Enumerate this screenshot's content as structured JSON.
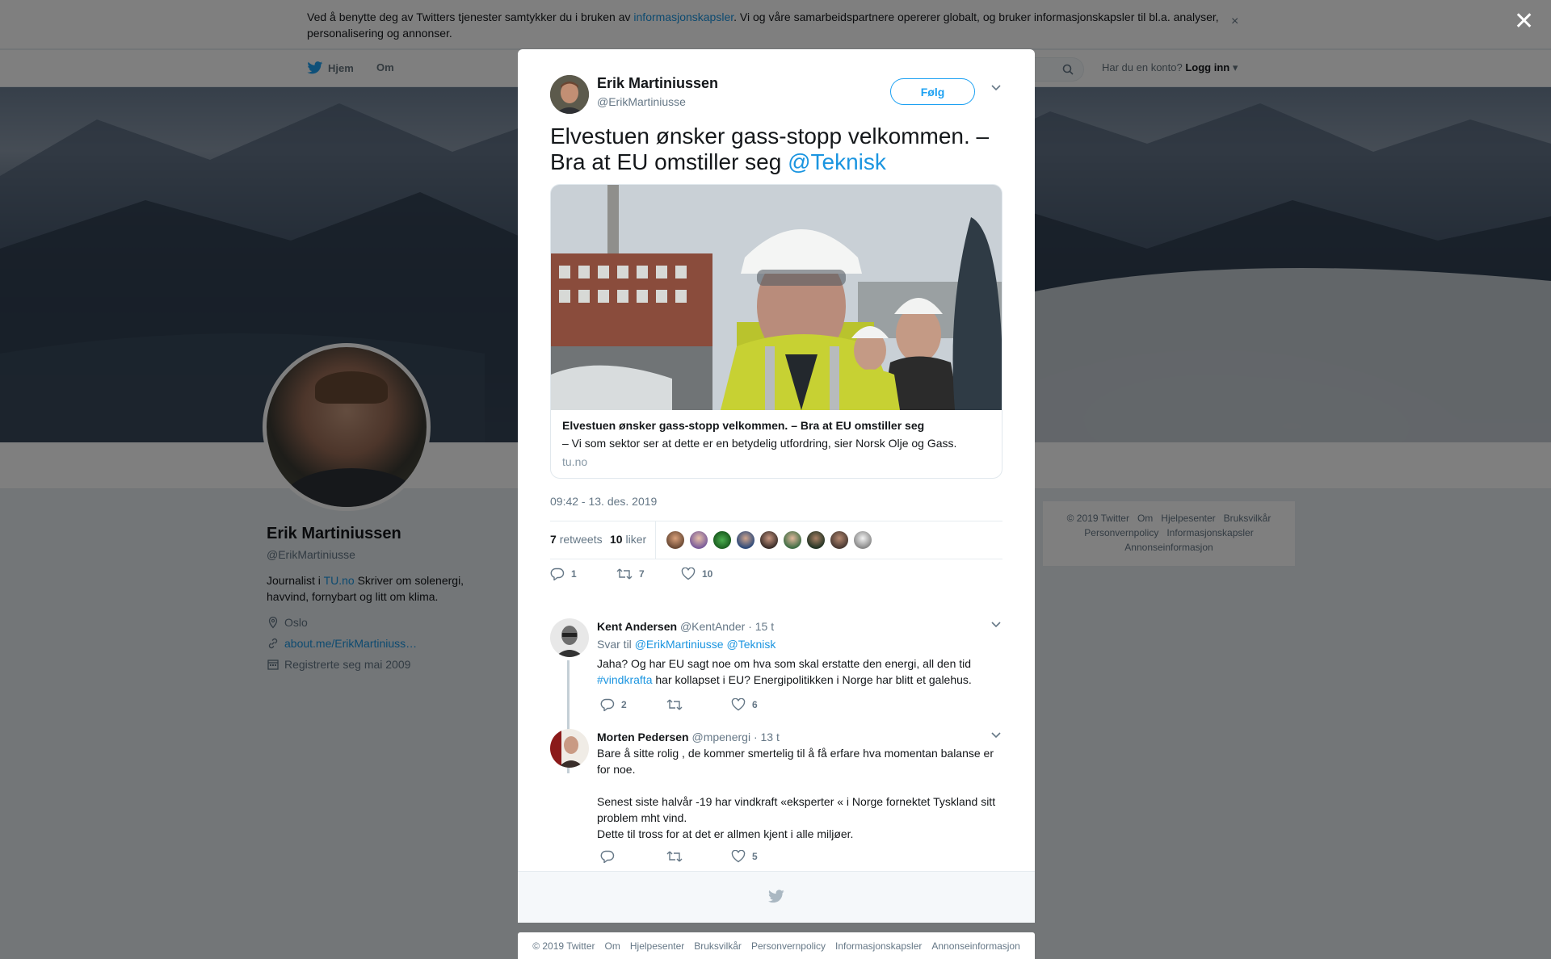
{
  "cookie_bar": {
    "text_before": "Ved å benytte deg av Twitters tjenester samtykker du i bruken av ",
    "link": "informasjonskapsler",
    "text_after": ". Vi og våre samarbeidspartnere opererer globalt, og bruker informasjonskapsler til bl.a. analyser, personalisering og annonser.",
    "close": "×"
  },
  "nav": {
    "home": "Hjem",
    "about": "Om",
    "login_prompt": "Har du en konto?",
    "login": "Logg inn"
  },
  "profile": {
    "name": "Erik Martiniussen",
    "handle": "@ErikMartiniusse",
    "bio_prefix": "Journalist i ",
    "bio_link": "TU.no",
    "bio_suffix": " Skriver om solenergi, havvind, fornybart og litt om klima.",
    "location": "Oslo",
    "website": "about.me/ErikMartiniuss…",
    "joined": "Registrerte seg mai 2009"
  },
  "side_footer": {
    "items": [
      "© 2019 Twitter",
      "Om",
      "Hjelpesenter",
      "Bruksvilkår",
      "Personvernpolicy",
      "Informasjonskapsler",
      "Annonseinformasjon"
    ]
  },
  "overlay_close": "✕",
  "tweet": {
    "author_name": "Erik Martiniussen",
    "author_handle": "@ErikMartiniusse",
    "follow_label": "Følg",
    "text": "Elvestuen ønsker gass-stopp velkommen. – Bra at EU omstiller seg ",
    "mention": "@Teknisk",
    "card": {
      "title": "Elvestuen ønsker gass-stopp velkommen. – Bra at EU omstiller seg",
      "description": "– Vi som sektor ser at dette er en betydelig utfordring, sier Norsk Olje og Gass.",
      "domain": "tu.no"
    },
    "timestamp": "09:42 - 13. des. 2019",
    "retweets_count": "7",
    "retweets_label": "retweets",
    "likes_count": "10",
    "likes_label": "liker",
    "actions": {
      "replies": "1",
      "retweets": "7",
      "likes": "10"
    }
  },
  "replies": [
    {
      "name": "Kent Andersen",
      "handle": "@KentAnder",
      "time": "· 15 t",
      "reply_to_label": "Svar til ",
      "reply_to_1": "@ErikMartiniusse",
      "reply_to_2": "@Teknisk",
      "text_1": "Jaha? Og har EU sagt noe om hva som skal erstatte den energi, all den tid ",
      "hashtag": "#vindkrafta",
      "text_2": " har kollapset i EU? Energipolitikken i Norge har blitt et galehus.",
      "replies": "2",
      "retweets": "",
      "likes": "6"
    },
    {
      "name": "Morten Pedersen",
      "handle": "@mpenergi",
      "time": "· 13 t",
      "text_1": "Bare å sitte rolig , de kommer smertelig til å få erfare hva momentan balanse er for noe.",
      "text_2": "Senest siste halvår -19 har vindkraft «eksperter « i Norge fornektet Tyskland sitt problem mht vind.",
      "text_3": "Dette til tross for at det er allmen kjent i alle miljøer.",
      "replies": "",
      "retweets": "",
      "likes": "5"
    }
  ],
  "bottom_footer": {
    "items": [
      "© 2019 Twitter",
      "Om",
      "Hjelpesenter",
      "Bruksvilkår",
      "Personvernpolicy",
      "Informasjonskapsler",
      "Annonseinformasjon"
    ]
  },
  "colors": {
    "accent": "#1da1f2",
    "link": "#1b95e0"
  }
}
